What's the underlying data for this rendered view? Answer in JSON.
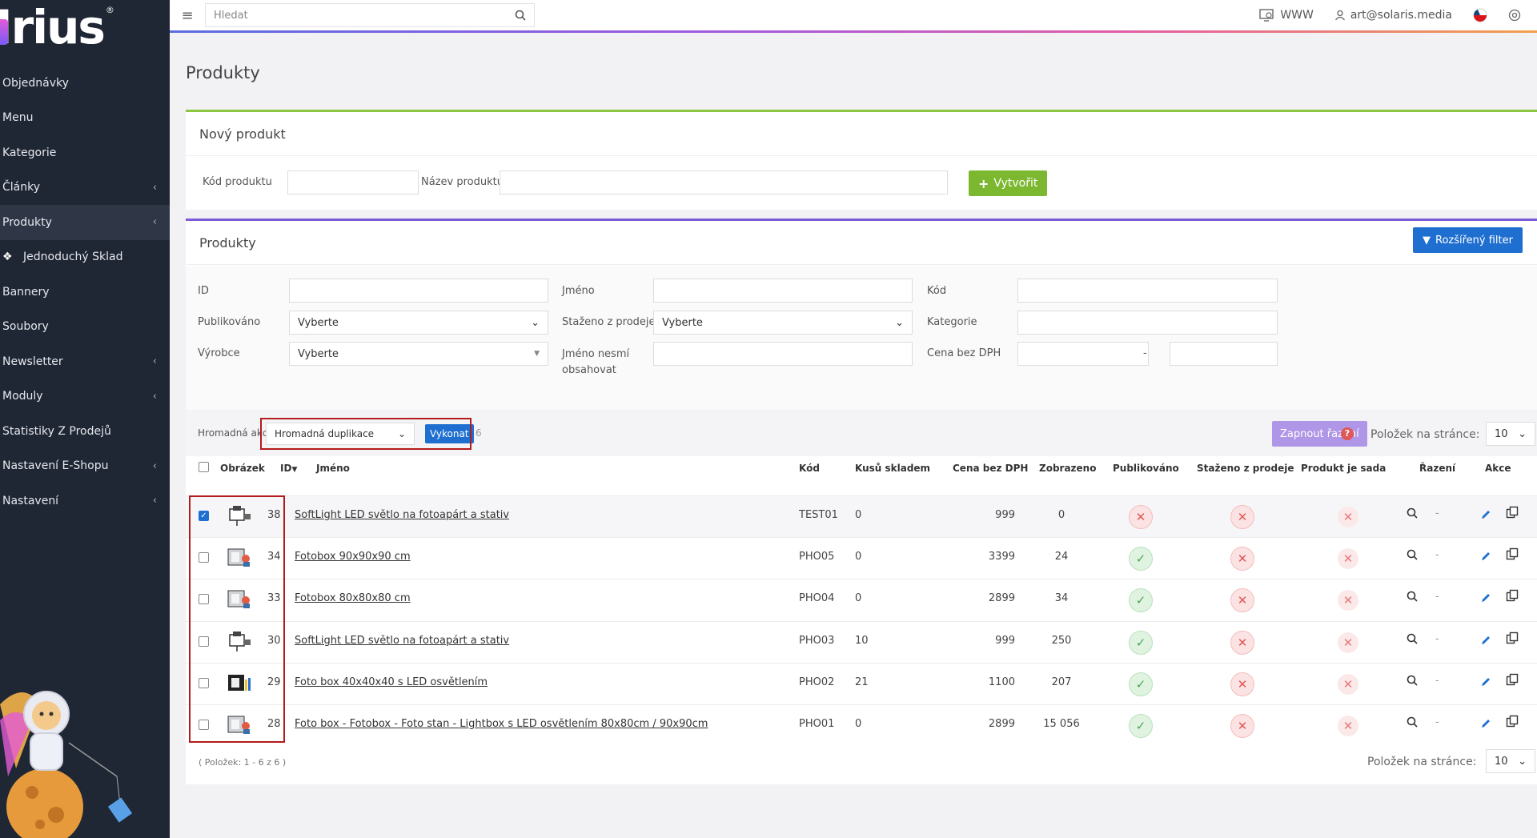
{
  "brand": {
    "logo_text": "Irius",
    "logo_reg": "®"
  },
  "sidebar": {
    "items": [
      {
        "label": "Objednávky",
        "has_arrow": false
      },
      {
        "label": "Menu",
        "has_arrow": false
      },
      {
        "label": "Kategorie",
        "has_arrow": false
      },
      {
        "label": "Články",
        "has_arrow": true
      },
      {
        "label": "Produkty",
        "has_arrow": true,
        "active": true
      },
      {
        "label": "Jednoduchý Sklad",
        "has_arrow": false,
        "icon": "dropbox-icon"
      },
      {
        "label": "Bannery",
        "has_arrow": false
      },
      {
        "label": "Soubory",
        "has_arrow": false
      },
      {
        "label": "Newsletter",
        "has_arrow": true
      },
      {
        "label": "Moduly",
        "has_arrow": true
      },
      {
        "label": "Statistiky Z Prodejů",
        "has_arrow": false
      },
      {
        "label": "Nastavení E-Shopu",
        "has_arrow": true
      },
      {
        "label": "Nastavení",
        "has_arrow": true
      }
    ]
  },
  "topbar": {
    "search_placeholder": "Hledat",
    "www_label": "WWW",
    "user_email": "art@solaris.media"
  },
  "page": {
    "title": "Produkty"
  },
  "new_product": {
    "title": "Nový produkt",
    "code_label": "Kód produktu",
    "name_label": "Název produktu",
    "create_button": "Vytvořit"
  },
  "products": {
    "title": "Produkty",
    "advanced_filter_button": "Rozšířený filter",
    "filters": {
      "id_label": "ID",
      "name_label": "Jméno",
      "code_label": "Kód",
      "published_label": "Publikováno",
      "published_value": "Vyberte",
      "withdrawn_label": "Staženo z prodeje",
      "withdrawn_value": "Vyberte",
      "category_label": "Kategorie",
      "manufacturer_label": "Výrobce",
      "manufacturer_value": "Vyberte",
      "name_exclude_label_1": "Jméno nesmí",
      "name_exclude_label_2": "obsahovat",
      "price_label": "Cena bez DPH",
      "price_separator": "-"
    },
    "bulk": {
      "label": "Hromadná akce",
      "action_value": "Hromadná duplikace",
      "execute_button": "Vykonat",
      "count": "6",
      "sort_button": "Zapnout řazení",
      "per_page_label": "Položek na stránce:",
      "per_page_value": "10"
    },
    "columns": {
      "image": "Obrázek",
      "id": "ID",
      "name": "Jméno",
      "code": "Kód",
      "stock": "Kusů skladem",
      "price": "Cena bez DPH",
      "views": "Zobrazeno",
      "published": "Publikováno",
      "withdrawn": "Staženo z prodeje",
      "is_set": "Produkt je sada",
      "order": "Řazení",
      "actions": "Akce"
    },
    "rows": [
      {
        "checked": true,
        "id": "38",
        "name": "SoftLight LED světlo na fotoapárt a stativ",
        "code": "TEST01",
        "stock": "0",
        "price": "999",
        "views": "0",
        "published": false,
        "order": "-"
      },
      {
        "checked": false,
        "id": "34",
        "name": "Fotobox 90x90x90 cm",
        "code": "PHO05",
        "stock": "0",
        "price": "3399",
        "views": "24",
        "published": true,
        "order": "-"
      },
      {
        "checked": false,
        "id": "33",
        "name": "Fotobox 80x80x80 cm",
        "code": "PHO04",
        "stock": "0",
        "price": "2899",
        "views": "34",
        "published": true,
        "order": "-"
      },
      {
        "checked": false,
        "id": "30",
        "name": "SoftLight LED světlo na fotoapárt a stativ",
        "code": "PHO03",
        "stock": "10",
        "price": "999",
        "views": "250",
        "published": true,
        "order": "-"
      },
      {
        "checked": false,
        "id": "29",
        "name": "Foto box 40x40x40 s LED osvětlením",
        "code": "PHO02",
        "stock": "21",
        "price": "1100",
        "views": "207",
        "published": true,
        "order": "-"
      },
      {
        "checked": false,
        "id": "28",
        "name": "Foto box - Fotobox - Foto stan - Lightbox s LED osvětlením 80x80cm / 90x90cm",
        "code": "PHO01",
        "stock": "0",
        "price": "2899",
        "views": "15 056",
        "published": true,
        "order": "-"
      }
    ],
    "footer_count": "( Položek: 1 - 6 z 6 )",
    "footer_per_page_label": "Položek na stránce:",
    "footer_per_page_value": "10"
  },
  "colors": {
    "sidebar": "#1f2634",
    "accent_green": "#7cb82f",
    "accent_blue": "#1f6fd1",
    "accent_purple": "#7c5cd6"
  }
}
